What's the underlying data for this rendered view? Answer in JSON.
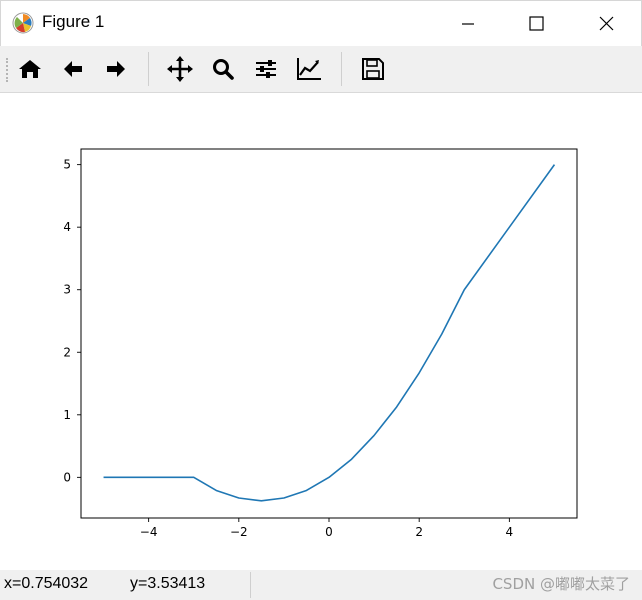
{
  "window": {
    "title": "Figure 1",
    "controls": {
      "minimize": "minimize-icon",
      "maximize": "maximize-icon",
      "close": "close-icon"
    }
  },
  "toolbar": {
    "buttons": [
      {
        "name": "home",
        "icon": "home-icon"
      },
      {
        "name": "back",
        "icon": "arrow-left-icon"
      },
      {
        "name": "forward",
        "icon": "arrow-right-icon"
      },
      {
        "name": "pan",
        "icon": "move-icon"
      },
      {
        "name": "zoom",
        "icon": "zoom-icon"
      },
      {
        "name": "subplots",
        "icon": "sliders-icon"
      },
      {
        "name": "customize",
        "icon": "line-chart-icon"
      },
      {
        "name": "save",
        "icon": "save-icon"
      }
    ]
  },
  "status": {
    "x_readout": "x=0.754032",
    "y_readout": "y=3.53413",
    "watermark": "CSDN @嘟嘟太菜了"
  },
  "chart_data": {
    "type": "line",
    "title": "",
    "xlabel": "",
    "ylabel": "",
    "xlim": [
      -5.5,
      5.5
    ],
    "ylim": [
      -0.65,
      5.25
    ],
    "x_ticks": [
      -4,
      -2,
      0,
      2,
      4
    ],
    "x_tick_labels": [
      "−4",
      "−2",
      "0",
      "2",
      "4"
    ],
    "y_ticks": [
      0,
      1,
      2,
      3,
      4,
      5
    ],
    "y_tick_labels": [
      "0",
      "1",
      "2",
      "3",
      "4",
      "5"
    ],
    "grid": false,
    "line_color": "#1f77b4",
    "series": [
      {
        "x": [
          -5,
          -4,
          -3,
          -2.5,
          -2,
          -1.5,
          -1,
          -0.5,
          0,
          0.5,
          1,
          1.5,
          2,
          2.5,
          3,
          4,
          5
        ],
        "y": [
          0,
          0,
          0,
          -0.21,
          -0.33,
          -0.375,
          -0.33,
          -0.21,
          0,
          0.29,
          0.67,
          1.125,
          1.67,
          2.29,
          3,
          4,
          5
        ]
      }
    ]
  }
}
